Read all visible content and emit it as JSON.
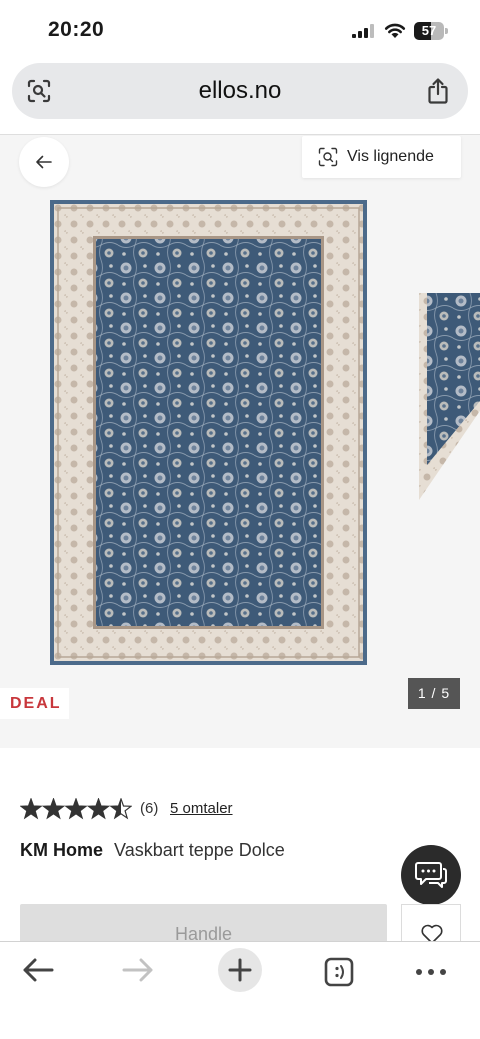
{
  "status_bar": {
    "time": "20:20",
    "battery_level": "57",
    "battery_fraction": 0.57,
    "icons": [
      "signal-icon",
      "wifi-icon",
      "battery-icon"
    ]
  },
  "browser": {
    "domain": "ellos.no",
    "icons": [
      "page-settings-icon",
      "share-icon"
    ]
  },
  "gallery": {
    "similar_label": "Vis lignende",
    "deal_label": "DEAL",
    "counter": "1 / 5",
    "colors": {
      "deal": "#c8373c",
      "counter_bg": "#555555",
      "rug_field": "#3e5a78",
      "rug_border": "#e6ded4"
    }
  },
  "product": {
    "rating": 4.5,
    "rating_max": 5,
    "rating_count": "(6)",
    "reviews_link": "5 omtaler",
    "brand": "KM Home",
    "name": "Vaskbart teppe Dolce"
  },
  "actions": {
    "buy_label": "Handle"
  },
  "toolbar": {
    "icons": [
      "back-arrow-icon",
      "forward-arrow-icon",
      "plus-icon",
      "tabs-icon",
      "more-icon"
    ]
  }
}
